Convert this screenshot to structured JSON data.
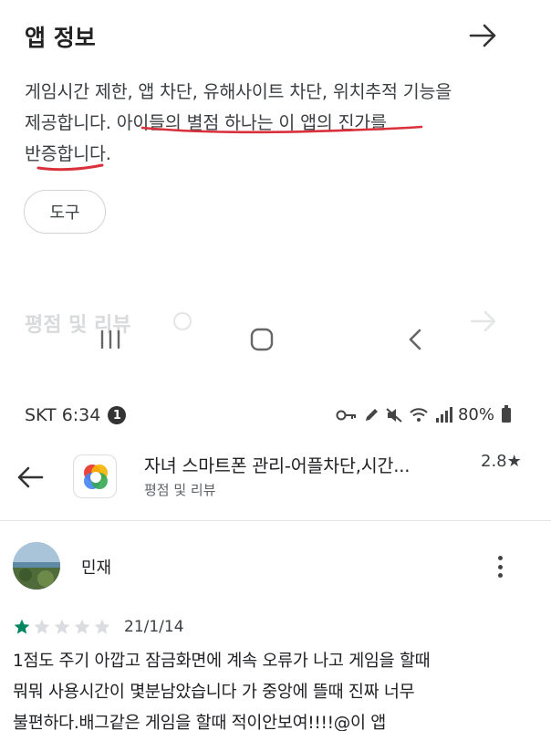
{
  "top": {
    "title": "앱 정보",
    "description_line1": "게임시간 제한, 앱 차단, 유해사이트 차단, 위치추적 기능을",
    "description_line2": "제공합니다. 아이들의 별점 하나는 이 앱의 진가를",
    "description_line3": "반증합니다.",
    "chip_label": "도구",
    "faded_section_label": "평점 및 리뷰",
    "underline_color": "#d9303b"
  },
  "bottom": {
    "status": {
      "carrier_time": "SKT 6:34",
      "notification_count": "1",
      "battery": "80%"
    },
    "app": {
      "name": "자녀 스마트폰 관리-어플차단,시간...",
      "rating": "2.8★",
      "subtitle": "평점 및 리뷰"
    },
    "review": {
      "author": "민재",
      "stars_filled": 1,
      "stars_total": 5,
      "date": "21/1/14",
      "text_line1": "1점도 주기 아깝고 잠금화면에 계속 오류가 나고 게임을 할때",
      "text_line2": "뭐뭐 사용시간이 몇분남았습니다 가 중앙에 뜰때 진짜 너무",
      "text_line3": "불편하다.배그같은 게임을 할때 적이안보여!!!!@이 앱"
    }
  },
  "colors": {
    "star_filled": "#01875f",
    "star_empty": "#dadce0"
  }
}
